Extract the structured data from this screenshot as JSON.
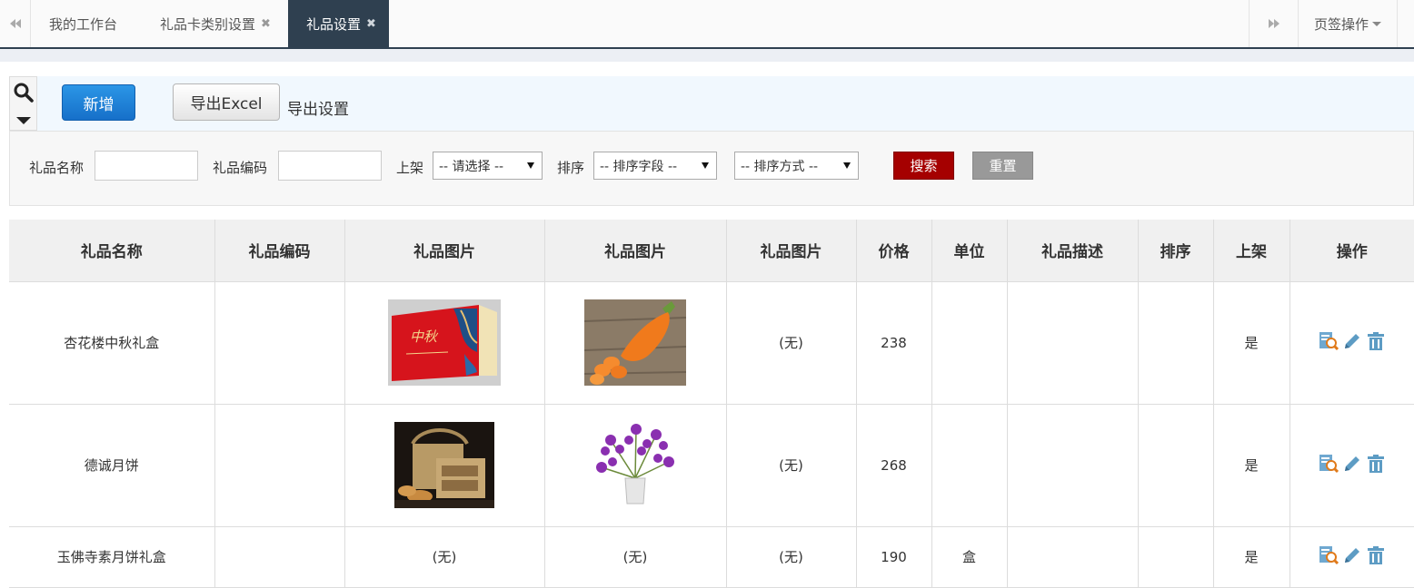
{
  "tabs": {
    "items": [
      {
        "label": "我的工作台",
        "closable": false,
        "active": false
      },
      {
        "label": "礼品卡类别设置",
        "closable": true,
        "active": false
      },
      {
        "label": "礼品设置",
        "closable": true,
        "active": true
      }
    ],
    "close_glyph": "✖",
    "page_ops_label": "页签操作",
    "prev_icon": "double-chevron-left-icon",
    "next_icon": "double-chevron-right-icon"
  },
  "toolbar": {
    "add_label": "新增",
    "export_label": "导出Excel",
    "export_settings_label": "导出设置"
  },
  "search": {
    "name_label": "礼品名称",
    "name_value": "",
    "code_label": "礼品编码",
    "code_value": "",
    "shelf_label": "上架",
    "shelf_selected": "-- 请选择 --",
    "sort_label": "排序",
    "sort_field_selected": "-- 排序字段 --",
    "sort_order_selected": "-- 排序方式 --",
    "search_button": "搜索",
    "reset_button": "重置"
  },
  "table": {
    "headers": [
      "礼品名称",
      "礼品编码",
      "礼品图片",
      "礼品图片",
      "礼品图片",
      "价格",
      "单位",
      "礼品描述",
      "排序",
      "上架",
      "操作"
    ],
    "rows": [
      {
        "name": "杏花楼中秋礼盒",
        "code": "",
        "image1": "red-gift-box-image",
        "image2": "carrot-image",
        "image3_text": "(无)",
        "price": "238",
        "unit": "",
        "desc": "",
        "sort": "",
        "on_shelf": "是"
      },
      {
        "name": "德诚月饼",
        "code": "",
        "image1": "wooden-mooncake-box-image",
        "image2": "purple-orchid-image",
        "image3_text": "(无)",
        "price": "268",
        "unit": "",
        "desc": "",
        "sort": "",
        "on_shelf": "是"
      },
      {
        "name": "玉佛寺素月饼礼盒",
        "code": "",
        "image1_text": "(无)",
        "image2_text": "(无)",
        "image3_text": "(无)",
        "price": "190",
        "unit": "盒",
        "desc": "",
        "sort": "",
        "on_shelf": "是"
      }
    ],
    "row_action_icons": [
      "view-detail-icon",
      "edit-pencil-icon",
      "delete-trash-icon"
    ]
  },
  "colors": {
    "active_tab_bg": "#2f4050",
    "add_button": "#1a7fd4",
    "search_button": "#a50000",
    "reset_button": "#999999",
    "action_icon": "#5d9cc4"
  }
}
